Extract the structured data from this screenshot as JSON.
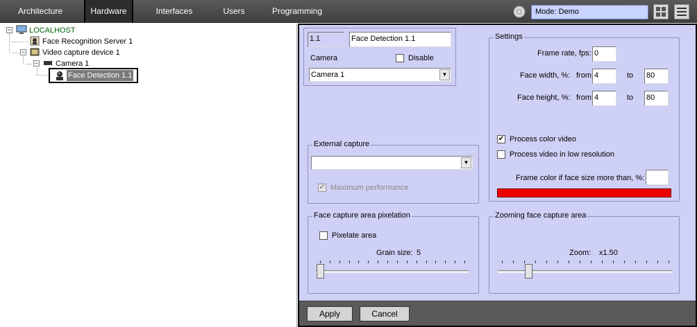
{
  "nav": {
    "tabs": [
      {
        "label": "Architecture"
      },
      {
        "label": "Hardware"
      },
      {
        "label": "Interfaces"
      },
      {
        "label": "Users"
      },
      {
        "label": "Programming"
      }
    ],
    "mode": "Mode: Demo"
  },
  "tree": {
    "localhost": "LOCALHOST",
    "face_server": "Face Recognition Server 1",
    "video_device": "Video capture device 1",
    "camera": "Camera 1",
    "face_detection": "Face Detection 1.1"
  },
  "header": {
    "id": "1.1",
    "name": "Face Detection 1.1",
    "camera_label": "Camera",
    "disable_label": "Disable",
    "camera_value": "Camera 1"
  },
  "settings": {
    "title": "Settings",
    "frame_rate_label": "Frame rate, fps:",
    "frame_rate": "0",
    "face_width_label": "Face width, %:",
    "face_height_label": "Face height, %:",
    "from_label": "from",
    "to_label": "to",
    "width_from": "4",
    "width_to": "80",
    "height_from": "4",
    "height_to": "80",
    "process_color_label": "Process color video",
    "process_color_checked": true,
    "process_low_res_label": "Process video in low resolution",
    "process_low_res_checked": false,
    "frame_color_label": "Frame color if face size more than, %:",
    "frame_color_value": "",
    "frame_color": "#ee0000"
  },
  "external_capture": {
    "title": "External capture",
    "value": "",
    "max_perf_label": "Maximum performance",
    "max_perf_checked": true
  },
  "pixelation": {
    "title": "Face capture area pixelation",
    "pixelate_label": "Pixelate area",
    "pixelate_checked": false,
    "grain_label": "Grain size:",
    "grain_value": "5",
    "grain_fraction": 0.0
  },
  "zoom": {
    "title": "Zooming face capture area",
    "zoom_label": "Zoom:",
    "zoom_value": "x1.50",
    "zoom_fraction": 0.16
  },
  "buttons": {
    "apply": "Apply",
    "cancel": "Cancel"
  }
}
